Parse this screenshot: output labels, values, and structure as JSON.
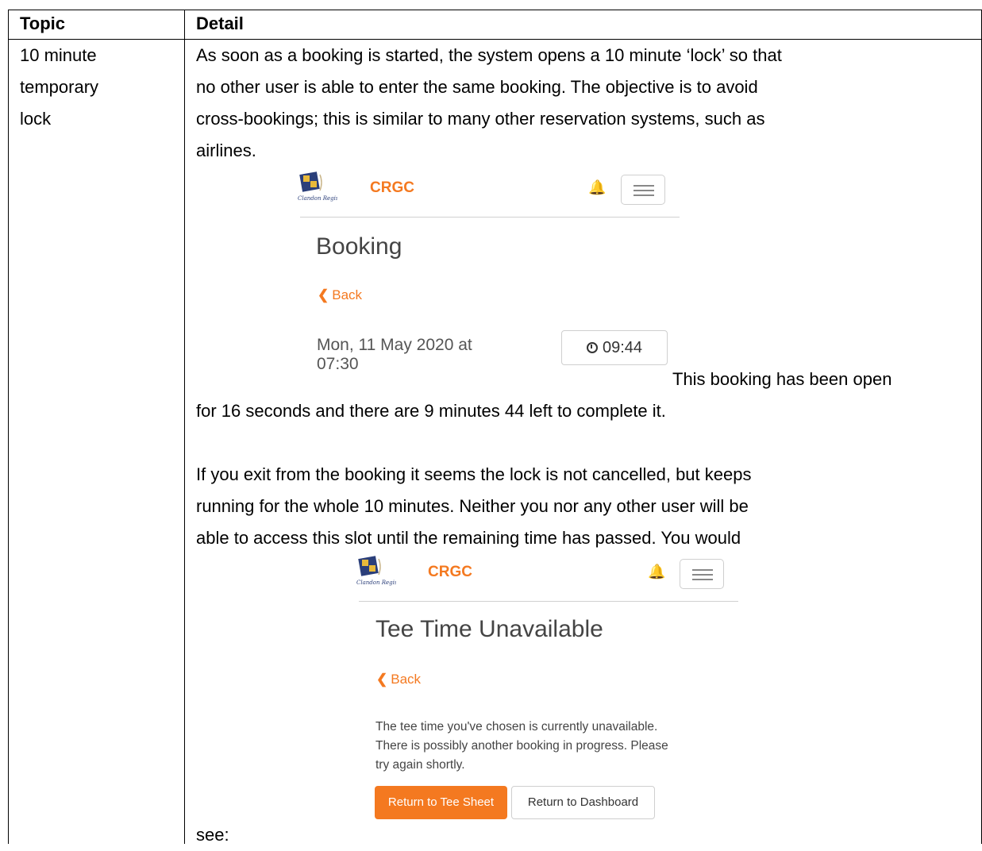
{
  "table": {
    "header_topic": "Topic",
    "header_detail": "Detail"
  },
  "row": {
    "topic_lines": [
      "10 minute",
      "temporary",
      "lock"
    ],
    "para1_lines": [
      "As soon as a booking is started, the system opens a 10 minute ‘lock’ so that",
      "no other user is able to enter the same booking.  The objective is to avoid",
      "cross-bookings; this is similar to many other reservation systems, such as",
      "airlines."
    ],
    "para2_inline": "This booking has been open",
    "para2_cont": "for 16 seconds and there are 9 minutes 44 left to complete it.",
    "para3_lines": [
      "If you exit from the booking it seems the lock is not cancelled, but keeps",
      "running for the whole 10 minutes.  Neither you nor any other user will be",
      "able to access this slot until the remaining time has passed.  You would"
    ],
    "para3_end": "see:"
  },
  "screenshot1": {
    "brand": "CRGC",
    "logo_text": "Clandon Regis",
    "heading": "Booking",
    "back": "Back",
    "datetime_line1": "Mon, 11 May 2020 at",
    "datetime_line2": "07:30",
    "timer": "09:44"
  },
  "screenshot2": {
    "brand": "CRGC",
    "logo_text": "Clandon Regis",
    "heading": "Tee Time Unavailable",
    "back": "Back",
    "message_lines": [
      "The tee time you've chosen is currently unavailable.",
      "There is possibly another booking in progress. Please",
      "try again shortly."
    ],
    "primary_button": "Return to Tee Sheet",
    "secondary_button": "Return to Dashboard"
  },
  "colors": {
    "brand_orange": "#f47920",
    "border": "#000000"
  }
}
